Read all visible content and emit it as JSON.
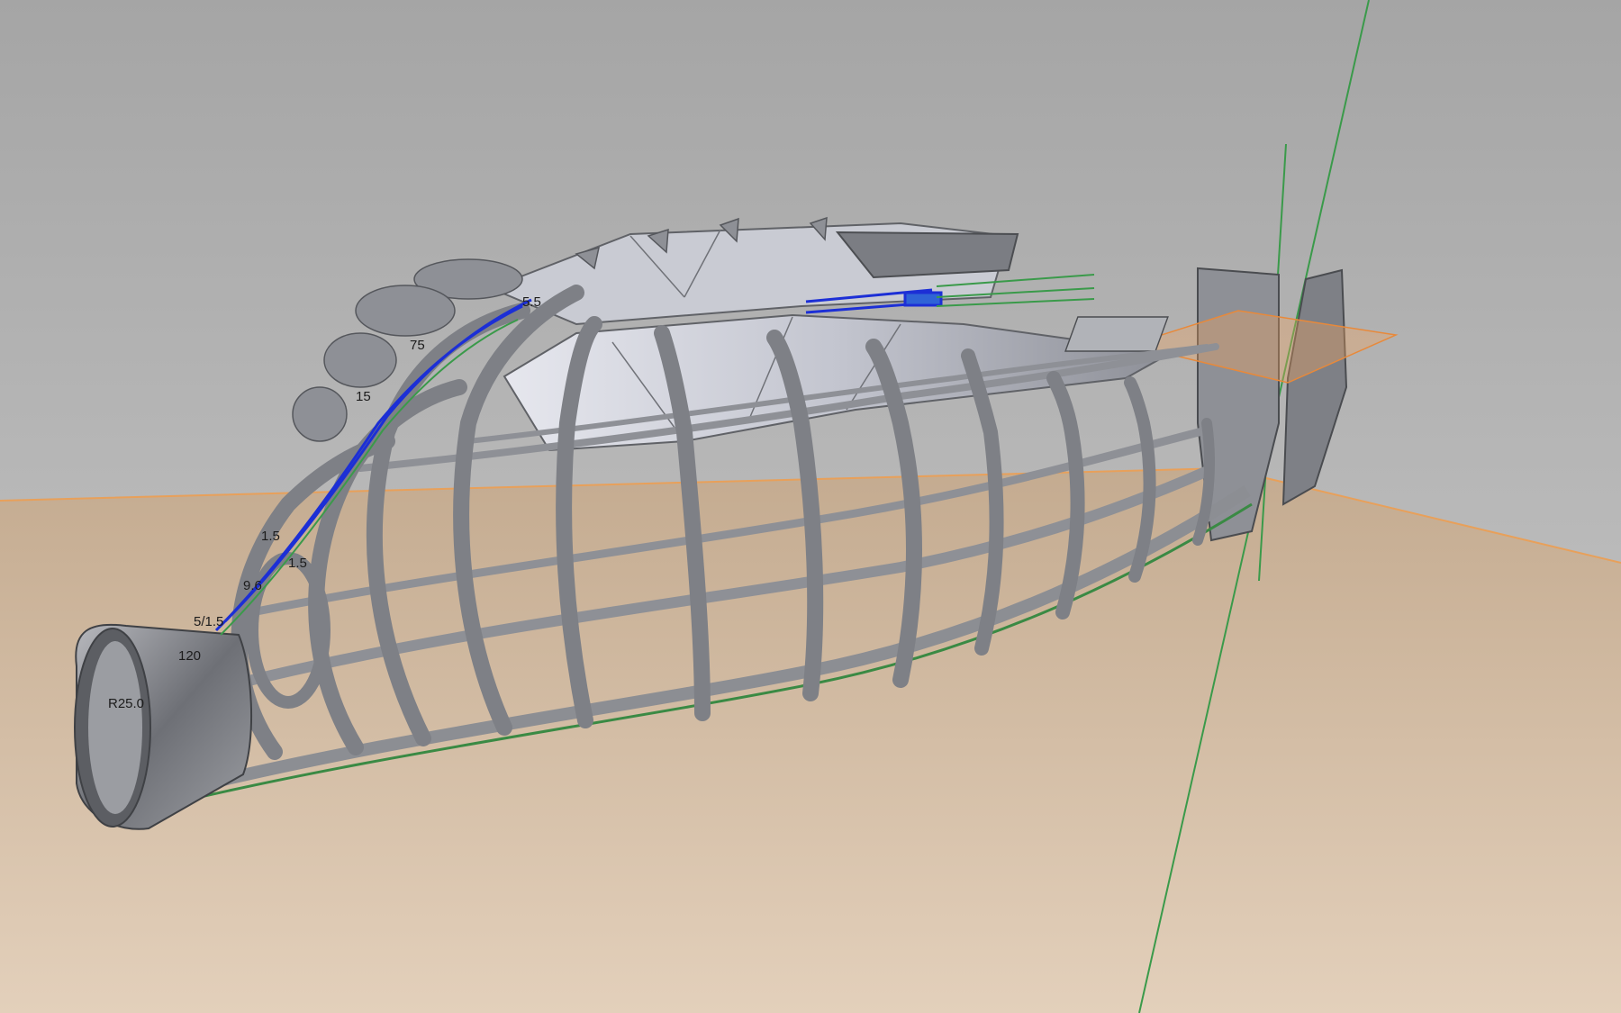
{
  "viewport": {
    "background_top": "#a7a7a7",
    "background_bottom": "#c9c9c9",
    "ground_near": "#c9b39a",
    "ground_far": "#e6d3bd",
    "ground_plane_edge": "#e8a05a",
    "axis_color": "#3a9a4a",
    "sketch_color": "#1c2fd6",
    "hull_color": "#8c8e93",
    "skin_color": "#c9cbd4",
    "section_plane_color": "#f3a45c"
  },
  "dimensions": [
    {
      "text": "1.5"
    },
    {
      "text": "120"
    },
    {
      "text": "5/1.5"
    },
    {
      "text": "9.6"
    },
    {
      "text": "R25.0"
    },
    {
      "text": "1.5"
    },
    {
      "text": "15"
    },
    {
      "text": "75"
    },
    {
      "text": "5.5"
    }
  ]
}
